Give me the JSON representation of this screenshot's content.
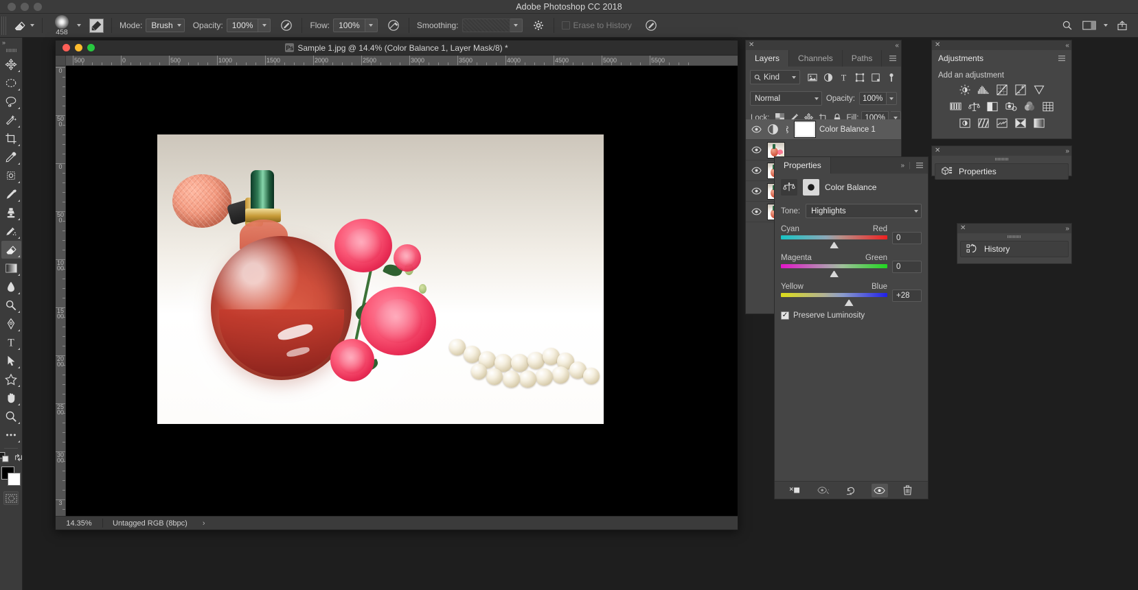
{
  "app": {
    "title": "Adobe Photoshop CC 2018"
  },
  "options_bar": {
    "tool_icon": "eraser-icon",
    "brush_size": "458",
    "preset_icon": "brush-preset-icon",
    "mode_label": "Mode:",
    "mode_value": "Brush",
    "opacity_label": "Opacity:",
    "opacity_value": "100%",
    "opacity_pressure_icon": "pressure-opacity-icon",
    "flow_label": "Flow:",
    "flow_value": "100%",
    "airbrush_icon": "airbrush-icon",
    "smoothing_label": "Smoothing:",
    "smoothing_value": "",
    "smoothing_gear_icon": "gear-icon",
    "erase_to_history_label": "Erase to History",
    "pressure_size_icon": "pressure-size-icon",
    "search_icon": "search-icon",
    "workspace_icon": "workspace-icon",
    "share_icon": "share-icon"
  },
  "toolbar": {
    "collapse_icon": "double-chevron-right-icon",
    "tools": [
      {
        "name": "move-tool",
        "icon": "move-icon",
        "selected": false
      },
      {
        "name": "marquee-tool",
        "icon": "elliptical-marquee-icon",
        "selected": false
      },
      {
        "name": "lasso-tool",
        "icon": "lasso-icon",
        "selected": false
      },
      {
        "name": "magic-wand-tool",
        "icon": "magic-wand-icon",
        "selected": false
      },
      {
        "name": "crop-tool",
        "icon": "crop-icon",
        "selected": false
      },
      {
        "name": "eyedropper-tool",
        "icon": "eyedropper-icon",
        "selected": false
      },
      {
        "name": "healing-brush-tool",
        "icon": "spot-healing-icon",
        "selected": false
      },
      {
        "name": "brush-tool",
        "icon": "brush-icon",
        "selected": false
      },
      {
        "name": "clone-stamp-tool",
        "icon": "clone-stamp-icon",
        "selected": false
      },
      {
        "name": "history-brush-tool",
        "icon": "history-brush-icon",
        "selected": false
      },
      {
        "name": "eraser-tool",
        "icon": "eraser-icon",
        "selected": true
      },
      {
        "name": "gradient-tool",
        "icon": "gradient-icon",
        "selected": false
      },
      {
        "name": "blur-tool",
        "icon": "blur-icon",
        "selected": false
      },
      {
        "name": "dodge-tool",
        "icon": "dodge-icon",
        "selected": false
      },
      {
        "name": "pen-tool",
        "icon": "pen-icon",
        "selected": false
      },
      {
        "name": "type-tool",
        "icon": "type-icon",
        "selected": false
      },
      {
        "name": "path-selection-tool",
        "icon": "path-selection-icon",
        "selected": false
      },
      {
        "name": "shape-tool",
        "icon": "custom-shape-icon",
        "selected": false
      },
      {
        "name": "hand-tool",
        "icon": "hand-icon",
        "selected": false
      },
      {
        "name": "zoom-tool",
        "icon": "zoom-icon",
        "selected": false
      },
      {
        "name": "edit-toolbar",
        "icon": "ellipsis-icon",
        "selected": false
      }
    ],
    "foreground_color": "#000000",
    "background_color": "#ffffff",
    "quick_mask_icon": "quick-mask-icon",
    "screen_mode_icon": "screen-mode-icon"
  },
  "document": {
    "title": "Sample 1.jpg @ 14.4% (Color Balance 1, Layer Mask/8) *",
    "badge": "ps-document-icon",
    "ruler_units_h": [
      "500",
      "0",
      "500",
      "1000",
      "1500",
      "2000",
      "2500",
      "3000",
      "3500",
      "4000",
      "4500",
      "5000",
      "5500"
    ],
    "ruler_units_v": [
      "0",
      "500",
      "0",
      "500",
      "1000",
      "1500",
      "2000",
      "2500",
      "3000",
      "3"
    ],
    "status": {
      "zoom": "14.35%",
      "color_mode": "Untagged RGB (8bpc)",
      "expand_icon": "chevron-right-icon"
    }
  },
  "layers_panel": {
    "close_icon": "close-icon",
    "collapse_icon": "double-chevron-right-icon",
    "tabs": [
      {
        "label": "Layers",
        "active": true
      },
      {
        "label": "Channels",
        "active": false
      },
      {
        "label": "Paths",
        "active": false
      }
    ],
    "menu_icon": "panel-menu-icon",
    "filter_label": "Kind",
    "filter_icon": "search-icon",
    "filter_type_icons": [
      "pixel-layer-filter-icon",
      "adjustment-layer-filter-icon",
      "type-layer-filter-icon",
      "shape-layer-filter-icon",
      "smart-object-filter-icon",
      "filter-toggle-icon"
    ],
    "blend_mode": "Normal",
    "opacity_label": "Opacity:",
    "opacity_value": "100%",
    "lock_label": "Lock:",
    "lock_icons": [
      "lock-transparent-pixels-icon",
      "lock-image-pixels-icon",
      "lock-position-icon",
      "lock-artboard-icon",
      "lock-all-icon"
    ],
    "fill_label": "Fill:",
    "fill_value": "100%",
    "layers": [
      {
        "name": "Color Balance 1",
        "type": "adjustment",
        "selected": true,
        "visible": true,
        "has_mask": true,
        "linked": true
      },
      {
        "name": "",
        "type": "pixel",
        "selected": false,
        "visible": true,
        "has_mask": false,
        "linked": false
      },
      {
        "name": "",
        "type": "pixel",
        "selected": false,
        "visible": true,
        "has_mask": false,
        "linked": false
      },
      {
        "name": "",
        "type": "pixel",
        "selected": false,
        "visible": true,
        "has_mask": false,
        "linked": false
      },
      {
        "name": "",
        "type": "pixel",
        "selected": false,
        "visible": true,
        "has_mask": false,
        "linked": false
      }
    ]
  },
  "properties_panel": {
    "tab_label": "Properties",
    "collapse_icon": "double-chevron-right-icon",
    "menu_icon": "panel-menu-icon",
    "adjustment_icon": "color-balance-icon",
    "mask_icon": "layer-mask-icon",
    "adjustment_title": "Color Balance",
    "tone_label": "Tone:",
    "tone_value": "Highlights",
    "sliders": [
      {
        "name": "cyan-red-slider",
        "left_label": "Cyan",
        "right_label": "Red",
        "value": "0",
        "position_pct": 50
      },
      {
        "name": "magenta-green-slider",
        "left_label": "Magenta",
        "right_label": "Green",
        "value": "0",
        "position_pct": 50
      },
      {
        "name": "yellow-blue-slider",
        "left_label": "Yellow",
        "right_label": "Blue",
        "value": "+28",
        "position_pct": 64
      }
    ],
    "preserve_luminosity_label": "Preserve Luminosity",
    "preserve_luminosity_checked": true,
    "footer_icons": [
      "clip-to-layer-icon",
      "view-previous-state-icon",
      "reset-icon",
      "toggle-visibility-icon",
      "delete-icon"
    ]
  },
  "adjustments_panel": {
    "close_icon": "close-icon",
    "collapse_icon": "double-chevron-left-icon",
    "tab_label": "Adjustments",
    "menu_icon": "panel-menu-icon",
    "heading": "Add an adjustment",
    "icons": [
      "brightness-contrast-icon",
      "levels-icon",
      "curves-icon",
      "exposure-icon",
      "vibrance-icon",
      "hue-saturation-icon",
      "color-balance-icon",
      "black-white-icon",
      "photo-filter-icon",
      "channel-mixer-icon",
      "color-lookup-icon",
      "invert-icon",
      "posterize-icon",
      "threshold-icon",
      "selective-color-icon",
      "gradient-map-icon"
    ]
  },
  "properties_dock": {
    "close_icon": "close-icon",
    "collapse_icon": "double-chevron-right-icon",
    "label": "Properties",
    "icon": "properties-icon"
  },
  "history_panel": {
    "close_icon": "close-icon",
    "collapse_icon": "double-chevron-right-icon",
    "label": "History",
    "icon": "history-icon"
  },
  "colors": {
    "chrome": "#3b3b3b",
    "panel": "#454545",
    "canvas": "#000000",
    "accent_text": "#e9e9e9"
  }
}
